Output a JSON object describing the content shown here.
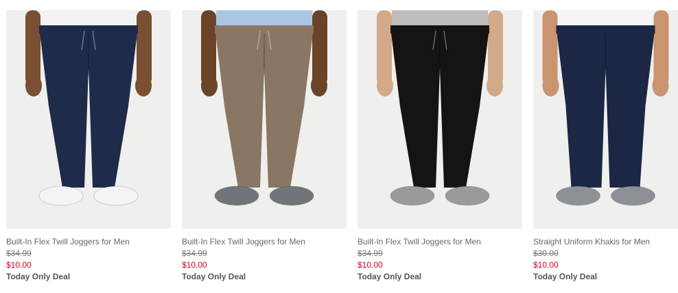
{
  "products": [
    {
      "title": "Built-In Flex Twill Joggers for Men",
      "original_price": "$34.99",
      "sale_price": "$10.00",
      "badge": "Today Only Deal",
      "pants_color": "#1e2b4a",
      "shirt_color": "#f2f2f2",
      "shoe_color": "#f4f4f4",
      "skin_color": "#7a4f33",
      "style": "jogger"
    },
    {
      "title": "Built-In Flex Twill Joggers for Men",
      "original_price": "$34.99",
      "sale_price": "$10.00",
      "badge": "Today Only Deal",
      "pants_color": "#8a7763",
      "shirt_color": "#a9c7e3",
      "shoe_color": "#6f757a",
      "skin_color": "#6b4328",
      "style": "jogger"
    },
    {
      "title": "Built-In Flex Twill Joggers for Men",
      "original_price": "$34.99",
      "sale_price": "$10.00",
      "badge": "Today Only Deal",
      "pants_color": "#141414",
      "shirt_color": "#bdbdbd",
      "shoe_color": "#9a9a9a",
      "skin_color": "#d4a988",
      "style": "jogger"
    },
    {
      "title": "Straight Uniform Khakis for Men",
      "original_price": "$30.00",
      "sale_price": "$10.00",
      "badge": "Today Only Deal",
      "pants_color": "#1b2744",
      "shirt_color": "#f4f4f4",
      "shoe_color": "#8d9196",
      "skin_color": "#c9946f",
      "style": "straight"
    }
  ]
}
